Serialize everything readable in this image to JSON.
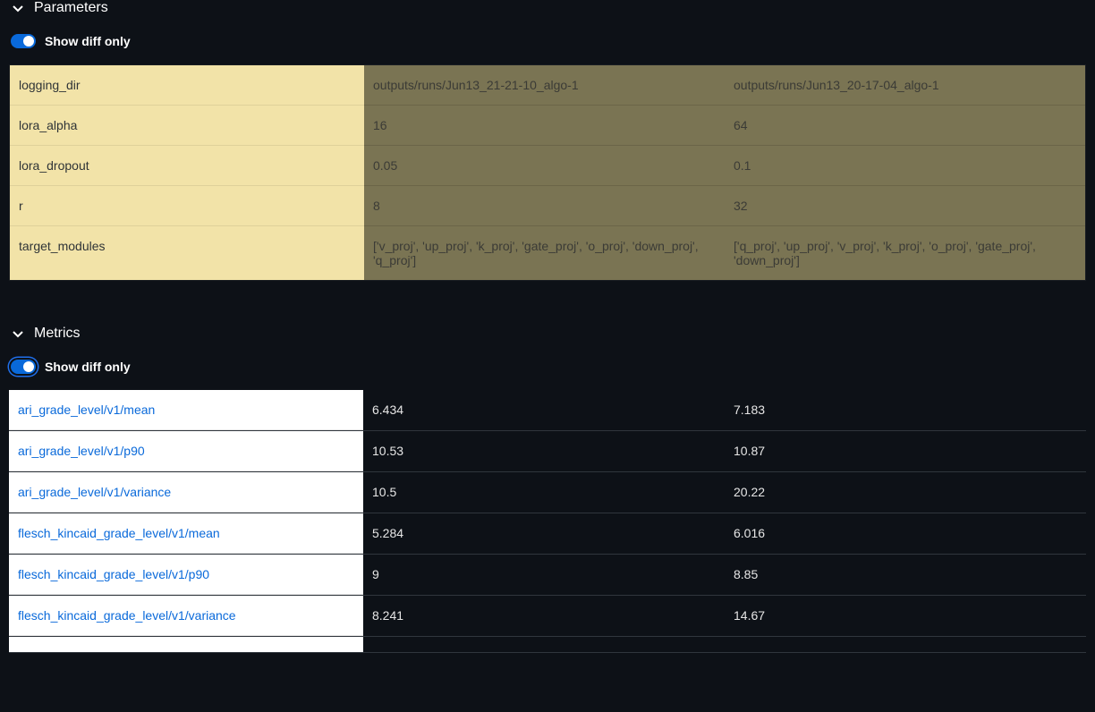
{
  "parameters": {
    "title": "Parameters",
    "toggleLabel": "Show diff only",
    "rows": [
      {
        "name": "logging_dir",
        "col1": "outputs/runs/Jun13_21-21-10_algo-1",
        "col2": "outputs/runs/Jun13_20-17-04_algo-1"
      },
      {
        "name": "lora_alpha",
        "col1": "16",
        "col2": "64"
      },
      {
        "name": "lora_dropout",
        "col1": "0.05",
        "col2": "0.1"
      },
      {
        "name": "r",
        "col1": "8",
        "col2": "32"
      },
      {
        "name": "target_modules",
        "col1": "['v_proj', 'up_proj', 'k_proj', 'gate_proj', 'o_proj', 'down_proj', 'q_proj']",
        "col2": "['q_proj', 'up_proj', 'v_proj', 'k_proj', 'o_proj', 'gate_proj', 'down_proj']"
      }
    ]
  },
  "metrics": {
    "title": "Metrics",
    "toggleLabel": "Show diff only",
    "rows": [
      {
        "name": "ari_grade_level/v1/mean",
        "col1": "6.434",
        "col2": "7.183"
      },
      {
        "name": "ari_grade_level/v1/p90",
        "col1": "10.53",
        "col2": "10.87"
      },
      {
        "name": "ari_grade_level/v1/variance",
        "col1": "10.5",
        "col2": "20.22"
      },
      {
        "name": "flesch_kincaid_grade_level/v1/mean",
        "col1": "5.284",
        "col2": "6.016"
      },
      {
        "name": "flesch_kincaid_grade_level/v1/p90",
        "col1": "9",
        "col2": "8.85"
      },
      {
        "name": "flesch_kincaid_grade_level/v1/variance",
        "col1": "8.241",
        "col2": "14.67"
      }
    ]
  }
}
